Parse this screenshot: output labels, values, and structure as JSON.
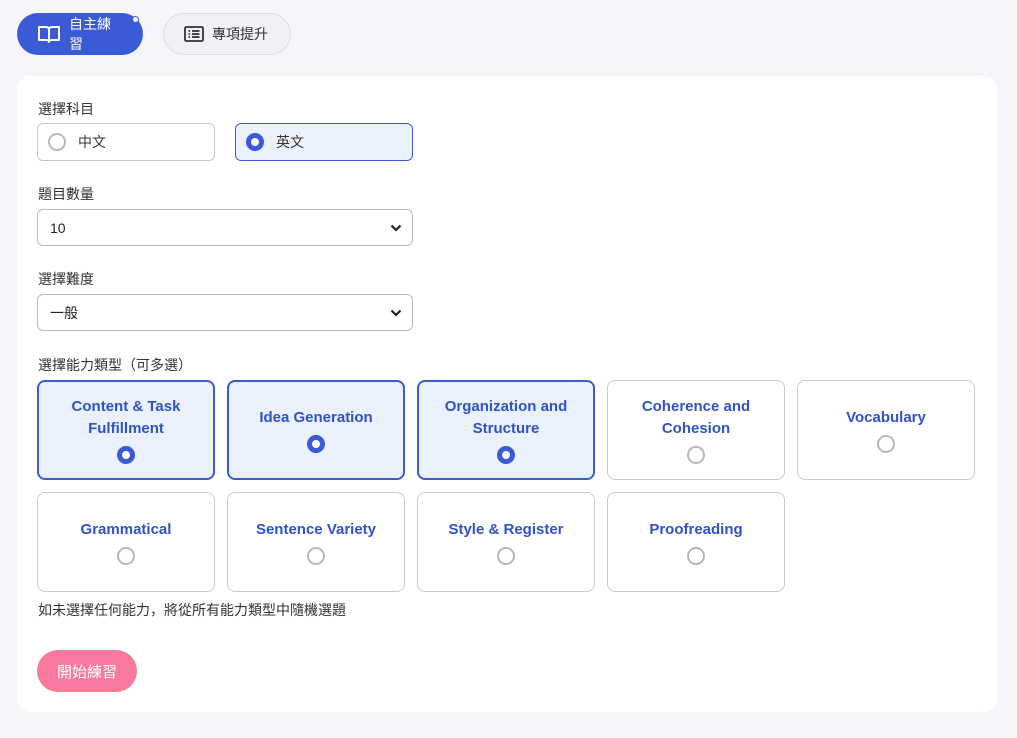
{
  "tabs": [
    {
      "label": "自主練習",
      "icon": "book-open-icon",
      "active": true
    },
    {
      "label": "專項提升",
      "icon": "list-icon",
      "active": false
    }
  ],
  "subject": {
    "label": "選擇科目",
    "options": [
      {
        "label": "中文",
        "selected": false
      },
      {
        "label": "英文",
        "selected": true
      }
    ]
  },
  "count": {
    "label": "題目數量",
    "value": "10"
  },
  "difficulty": {
    "label": "選擇難度",
    "value": "一般"
  },
  "abilities": {
    "label": "選擇能力類型（可多選）",
    "items": [
      {
        "label": "Content & Task Fulfillment",
        "selected": true
      },
      {
        "label": "Idea Generation",
        "selected": true
      },
      {
        "label": "Organization and Structure",
        "selected": true
      },
      {
        "label": "Coherence and Cohesion",
        "selected": false
      },
      {
        "label": "Vocabulary",
        "selected": false
      },
      {
        "label": "Grammatical",
        "selected": false
      },
      {
        "label": "Sentence Variety",
        "selected": false
      },
      {
        "label": "Style & Register",
        "selected": false
      },
      {
        "label": "Proofreading",
        "selected": false
      }
    ],
    "hint": "如未選擇任何能力，將從所有能力類型中隨機選題"
  },
  "start_label": "開始練習",
  "colors": {
    "accent": "#3b5bd6",
    "start_button": "#f77a9e",
    "selected_bg": "#eaf1fd"
  }
}
